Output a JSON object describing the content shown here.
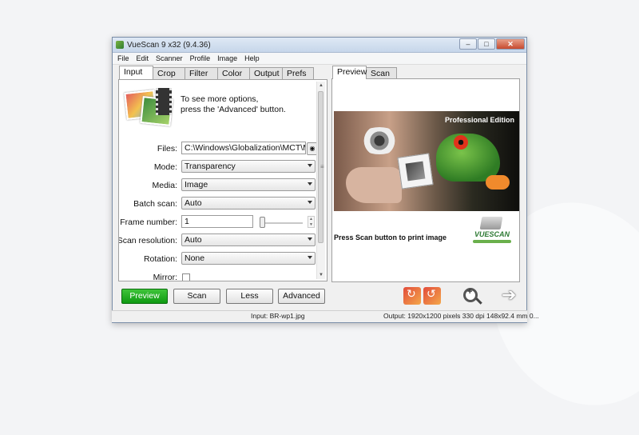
{
  "window": {
    "title": "VueScan 9 x32 (9.4.36)"
  },
  "menu": [
    "File",
    "Edit",
    "Scanner",
    "Profile",
    "Image",
    "Help"
  ],
  "left_tabs": [
    "Input",
    "Crop",
    "Filter",
    "Color",
    "Output",
    "Prefs"
  ],
  "right_tabs": [
    "Preview",
    "Scan"
  ],
  "hint": {
    "line1": "To see more options,",
    "line2": "press the 'Advanced' button."
  },
  "fields": {
    "files": {
      "label": "Files:",
      "value": "C:\\Windows\\Globalization\\MCT\\M"
    },
    "mode": {
      "label": "Mode:",
      "value": "Transparency"
    },
    "media": {
      "label": "Media:",
      "value": "Image"
    },
    "batch": {
      "label": "Batch scan:",
      "value": "Auto"
    },
    "frame": {
      "label": "Frame number:",
      "value": "1"
    },
    "resolution": {
      "label": "Scan resolution:",
      "value": "Auto"
    },
    "rotation": {
      "label": "Rotation:",
      "value": "None"
    },
    "mirror": {
      "label": "Mirror:"
    }
  },
  "preview": {
    "edition": "Professional Edition",
    "press_text": "Press Scan button to print image",
    "logo_text": "VUESCAN"
  },
  "buttons": {
    "preview": "Preview",
    "scan": "Scan",
    "less": "Less",
    "advanced": "Advanced"
  },
  "status": {
    "input": "Input: BR-wp1.jpg",
    "output": "Output: 1920x1200 pixels 330 dpi 148x92.4 mm 0..."
  },
  "colors": {
    "preview_button": "#1aa51a",
    "title_bar": "#c6d6ea"
  }
}
